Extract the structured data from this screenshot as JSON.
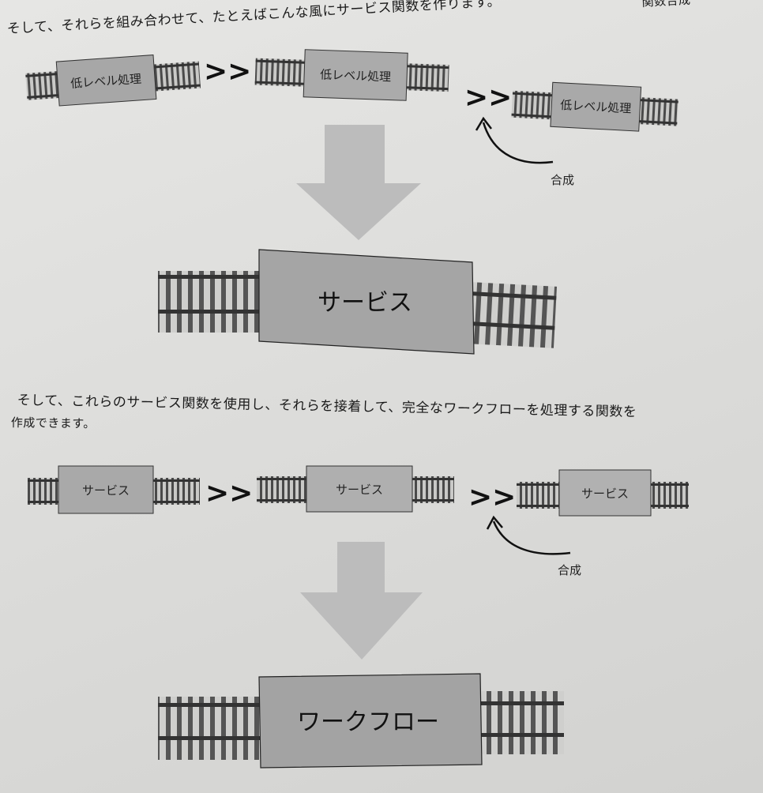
{
  "text": {
    "top_fragment": "関数合成",
    "intro_line": "そして、それらを組み合わせて、たとえばこんな風にサービス関数を作ります。",
    "para_line1": "そして、これらのサービス関数を使用し、それらを接着して、完全なワークフローを処理する関数を",
    "para_line2": "作成できます。"
  },
  "diagram1": {
    "boxes": [
      "低レベル処理",
      "低レベル処理",
      "低レベル処理"
    ],
    "operator": ">>",
    "compose_label": "合成",
    "result_label": "サービス"
  },
  "diagram2": {
    "boxes": [
      "サービス",
      "サービス",
      "サービス"
    ],
    "operator": ">>",
    "compose_label": "合成",
    "result_label": "ワークフロー"
  },
  "colors": {
    "paper": "#e2e2e0",
    "box_fill": "#a9a9a9",
    "box_fill_small": "#b0b0b0",
    "arrow": "#bdbdbd",
    "rail": "#3a3a3a",
    "tie": "#c8c8c8"
  }
}
